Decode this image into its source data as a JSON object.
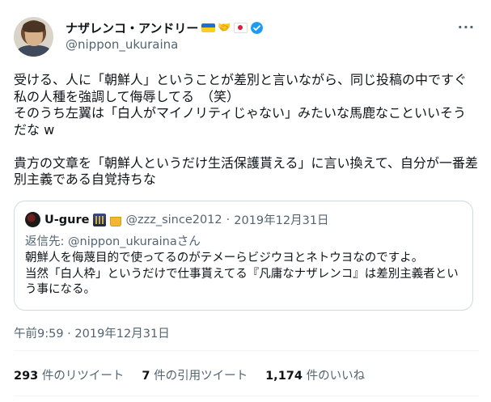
{
  "author": {
    "display_name": "ナザレンコ・アンドリー",
    "handle": "@nippon_ukuraina",
    "badges": [
      "flag-ukraine",
      "handshake",
      "flag-japan",
      "verified-badge"
    ]
  },
  "tweet": {
    "paragraph1": "受ける、人に「朝鮮人」ということが差別と言いながら、同じ投稿の中ですぐ私の人種を強調して侮辱してる　（笑）\nそのうち左翼は「白人がマイノリティじゃない」みたいな馬鹿なこといいそうだな w",
    "paragraph2": "貴方の文章を「朝鮮人というだけ生活保護貰える」に言い換えて、自分が一番差別主義である自覚持ちな"
  },
  "quoted_tweet": {
    "display_name": "U-gure",
    "handle": "@zzz_since2012",
    "separator": "·",
    "date": "2019年12月31日",
    "reply_prefix": "返信先: ",
    "reply_to": "@nippon_ukurainaさん",
    "text": "朝鮮人を侮蔑目的で使ってるのがテメーらビジウヨとネトウヨなのですよ。\n当然「白人枠」というだけで仕事貰えてる『凡庸なナザレンコ』は差別主義者という事になる。"
  },
  "timestamp": "午前9:59 · 2019年12月31日",
  "stats": {
    "retweets_count": "293",
    "retweets_label": "件のリツイート",
    "quotes_count": "7",
    "quotes_label": "件の引用ツイート",
    "likes_count": "1,174",
    "likes_label": "件のいいね"
  },
  "colors": {
    "accent_blue": "#1d9bf0",
    "secondary_text": "#536471",
    "border": "#cfd9de"
  }
}
